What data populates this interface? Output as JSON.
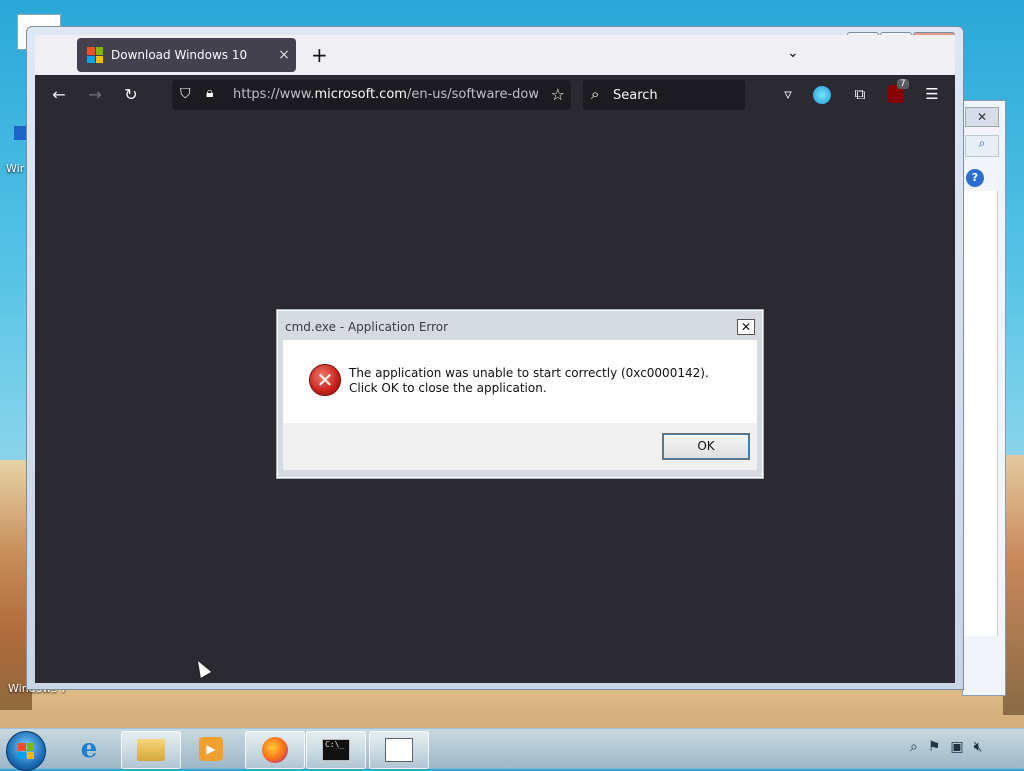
{
  "desktop": {
    "labels": [
      "Wir",
      "Windows 7"
    ]
  },
  "browser": {
    "tab": {
      "title": "Download Windows 10",
      "close": "×"
    },
    "new_tab": "+",
    "list_tabs": "⌄",
    "window_controls": {
      "minimize": "▭",
      "maximize": "□",
      "close": "✕"
    },
    "nav": {
      "back": "←",
      "forward": "→",
      "reload": "↻"
    },
    "url": {
      "scheme": "https://www.",
      "domain": "microsoft.com",
      "path": "/en-us/software-download"
    },
    "search_placeholder": "Search",
    "extension_badge": "7"
  },
  "dialog": {
    "title": "cmd.exe - Application Error",
    "close": "✕",
    "message": "The application was unable to start correctly (0xc0000142). Click OK to close the application.",
    "ok_label": "OK",
    "icon_glyph": "✕"
  },
  "back_window": {
    "close": "✕",
    "help": "?"
  },
  "taskbar": {
    "items": [
      "start",
      "internet-explorer",
      "file-explorer",
      "media-player",
      "firefox",
      "cmd",
      "app"
    ],
    "cmd_text": "C:\\_"
  },
  "colors": {
    "firefox_dark": "#2b2a33",
    "urlbar": "#1c1b22",
    "dialog_border": "#a9b4c2",
    "error_red": "#c8201a"
  }
}
